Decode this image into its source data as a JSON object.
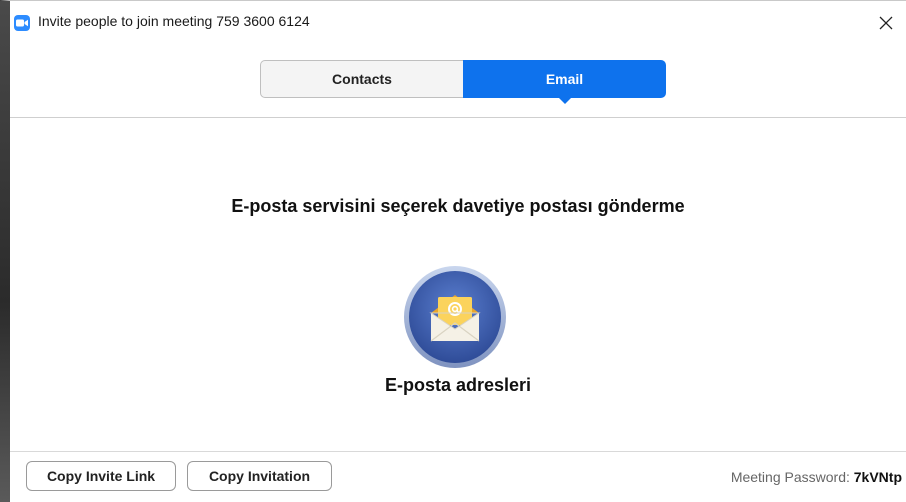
{
  "window": {
    "title": "Invite people to join meeting 759 3600 6124"
  },
  "tabs": [
    {
      "label": "Contacts",
      "active": false
    },
    {
      "label": "Email",
      "active": true
    }
  ],
  "main": {
    "heading": "E-posta servisini seçerek davetiye postası gönderme",
    "services": [
      {
        "label": "E-posta adresleri",
        "icon": "envelope-at-icon"
      }
    ]
  },
  "footer": {
    "copy_invite_link_label": "Copy Invite Link",
    "copy_invitation_label": "Copy Invitation",
    "password_label": "Meeting Password:",
    "password_value": "7kVNtp"
  },
  "colors": {
    "accent": "#0e72ed",
    "app_icon": "#2d8cff",
    "service_circle": "#3d5aa8",
    "envelope": "#f5b73b"
  }
}
